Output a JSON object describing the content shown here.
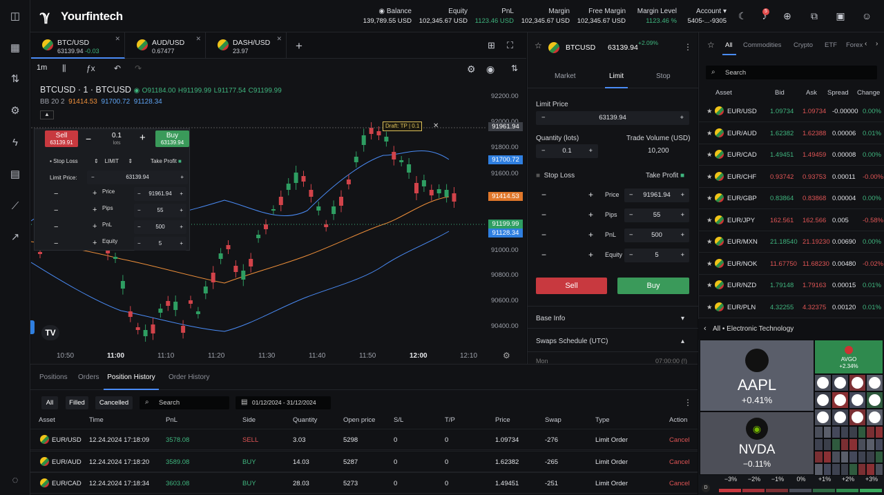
{
  "app": {
    "name": "Yourfintech"
  },
  "header": {
    "stats": [
      {
        "label": "Balance",
        "value": "139,789.55 USD"
      },
      {
        "label": "Equity",
        "value": "102,345.67 USD"
      },
      {
        "label": "PnL",
        "value": "1123.46 USD"
      },
      {
        "label": "Margin",
        "value": "102,345.67 USD"
      },
      {
        "label": "Free Margin",
        "value": "102,345.67 USD"
      },
      {
        "label": "Margin Level",
        "value": "1123.46 %"
      },
      {
        "label": "Account",
        "value": "5405-...-9305"
      }
    ],
    "notifications": "5"
  },
  "tabs": [
    {
      "name": "BTC/USD",
      "price": "63139.94",
      "change": "-0.03"
    },
    {
      "name": "AUD/USD",
      "price": "0.67477",
      "change": ""
    },
    {
      "name": "DASH/USD",
      "price": "23.97",
      "change": ""
    }
  ],
  "chart": {
    "interval": "1m",
    "symbol": "BTCUSD · 1 · BTCUSD",
    "ohlc": {
      "o": "91184.00",
      "h": "91199.99",
      "l": "91177.54",
      "c": "91199.99"
    },
    "bb": {
      "label": "BB 20 2",
      "v1": "91414.53",
      "v2": "91700.72",
      "v3": "91128.34"
    },
    "price_labels": [
      "92200.00",
      "92000.00",
      "91800.00",
      "91600.00",
      "91200.00",
      "91000.00",
      "90800.00",
      "90600.00",
      "90400.00"
    ],
    "price_boxes": [
      "91961.94",
      "91700.72",
      "91414.53",
      "91199.99",
      "91128.34"
    ],
    "time_labels": [
      "10:50",
      "11:00",
      "11:10",
      "11:20",
      "11:30",
      "11:40",
      "11:50",
      "12:00",
      "12:10"
    ],
    "draft": "Draft: TP | 0.1"
  },
  "ot": {
    "sell": "Sell",
    "sell_price": "63139.91",
    "qty": "0.1",
    "lots": "lots",
    "buy": "Buy",
    "buy_price": "63139.94",
    "stop_loss": "Stop Loss",
    "limit": "LIMIT",
    "take_profit": "Take Profit",
    "limit_price_label": "Limit Price:",
    "limit_price": "63139.94",
    "rows": [
      {
        "label": "Price",
        "value": "91961.94"
      },
      {
        "label": "Pips",
        "value": "55"
      },
      {
        "label": "PnL",
        "value": "500"
      },
      {
        "label": "Equity",
        "value": "5"
      }
    ]
  },
  "order": {
    "symbol": "BTCUSD",
    "price": "63139.94",
    "change": "+2.09%",
    "types": [
      "Market",
      "Limit",
      "Stop"
    ],
    "limit_price_label": "Limit Price",
    "limit_price": "63139.94",
    "qty_label": "Quantity (lots)",
    "qty": "0.1",
    "vol_label": "Trade Volume (USD)",
    "vol": "10,200",
    "stop_loss": "Stop Loss",
    "take_profit": "Take Profit",
    "rows": [
      {
        "label": "Price",
        "value": "91961.94"
      },
      {
        "label": "Pips",
        "value": "55"
      },
      {
        "label": "PnL",
        "value": "500"
      },
      {
        "label": "Equity",
        "value": "5"
      }
    ],
    "sell": "Sell",
    "buy": "Buy",
    "base_info": "Base Info",
    "swaps": "Swaps Schedule (UTC)",
    "mon": "Mon",
    "mon_time": "07:00:00 (!)"
  },
  "watchlist": {
    "tabs": [
      "All",
      "Commodities",
      "Crypto",
      "ETF",
      "Forex"
    ],
    "search": "Search",
    "headers": [
      "Asset",
      "Bid",
      "Ask",
      "Spread",
      "Change"
    ],
    "rows": [
      {
        "asset": "EUR/USD",
        "bid": "1.09734",
        "ask": "1.09734",
        "spread": "-0.00000",
        "change": "0.00%",
        "dir": "g"
      },
      {
        "asset": "EUR/AUD",
        "bid": "1.62382",
        "ask": "1.62388",
        "spread": "0.00006",
        "change": "0.01%",
        "dir": "g"
      },
      {
        "asset": "EUR/CAD",
        "bid": "1.49451",
        "ask": "1.49459",
        "spread": "0.00008",
        "change": "0.00%",
        "dir": "g"
      },
      {
        "asset": "EUR/CHF",
        "bid": "0.93742",
        "ask": "0.93753",
        "spread": "0.00011",
        "change": "-0.00%",
        "dir": "r"
      },
      {
        "asset": "EUR/GBP",
        "bid": "0.83864",
        "ask": "0.83868",
        "spread": "0.00004",
        "change": "0.00%",
        "dir": "g"
      },
      {
        "asset": "EUR/JPY",
        "bid": "162.561",
        "ask": "162.566",
        "spread": "0.005",
        "change": "-0.58%",
        "dir": "r"
      },
      {
        "asset": "EUR/MXN",
        "bid": "21.18540",
        "ask": "21.19230",
        "spread": "0.00690",
        "change": "0.00%",
        "dir": "g"
      },
      {
        "asset": "EUR/NOK",
        "bid": "11.67750",
        "ask": "11.68230",
        "spread": "0.00480",
        "change": "-0.02%",
        "dir": "r"
      },
      {
        "asset": "EUR/NZD",
        "bid": "1.79148",
        "ask": "1.79163",
        "spread": "0.00015",
        "change": "0.01%",
        "dir": "g"
      },
      {
        "asset": "EUR/PLN",
        "bid": "4.32255",
        "ask": "4.32375",
        "spread": "0.00120",
        "change": "0.01%",
        "dir": "g"
      }
    ]
  },
  "heatmap": {
    "crumb": "All • Electronic Technology",
    "aapl": "AAPL",
    "aapl_ch": "+0.41%",
    "nvda": "NVDA",
    "nvda_ch": "−0.11%",
    "avgo": "AVGO",
    "avgo_ch": "+2.34%",
    "scale": [
      "−3%",
      "−2%",
      "−1%",
      "0%",
      "+1%",
      "+2%",
      "+3%"
    ]
  },
  "bottom": {
    "tabs": [
      "Positions",
      "Orders",
      "Position History",
      "Order History"
    ],
    "filters": [
      "All",
      "Filled",
      "Cancelled"
    ],
    "search": "Search",
    "date": "01/12/2024 - 31/12/2024",
    "headers": [
      "Asset",
      "Time",
      "PnL",
      "Side",
      "Quantity",
      "Open price",
      "S/L",
      "T/P",
      "Price",
      "Swap",
      "Type",
      "Action"
    ],
    "rows": [
      {
        "asset": "EUR/USD",
        "time": "12.24.2024 17:18:09",
        "pnl": "3578.08",
        "side": "SELL",
        "qty": "3.03",
        "open": "5298",
        "sl": "0",
        "tp": "0",
        "price": "1.09734",
        "swap": "-276",
        "type": "Limit Order",
        "action": "Cancel"
      },
      {
        "asset": "EUR/AUD",
        "time": "12.24.2024 17:18:20",
        "pnl": "3589.08",
        "side": "BUY",
        "qty": "14.03",
        "open": "5287",
        "sl": "0",
        "tp": "0",
        "price": "1.62382",
        "swap": "-265",
        "type": "Limit Order",
        "action": "Cancel"
      },
      {
        "asset": "EUR/CAD",
        "time": "12.24.2024 17:18:34",
        "pnl": "3603.08",
        "side": "BUY",
        "qty": "28.03",
        "open": "5273",
        "sl": "0",
        "tp": "0",
        "price": "1.49451",
        "swap": "-251",
        "type": "Limit Order",
        "action": "Cancel"
      }
    ]
  }
}
